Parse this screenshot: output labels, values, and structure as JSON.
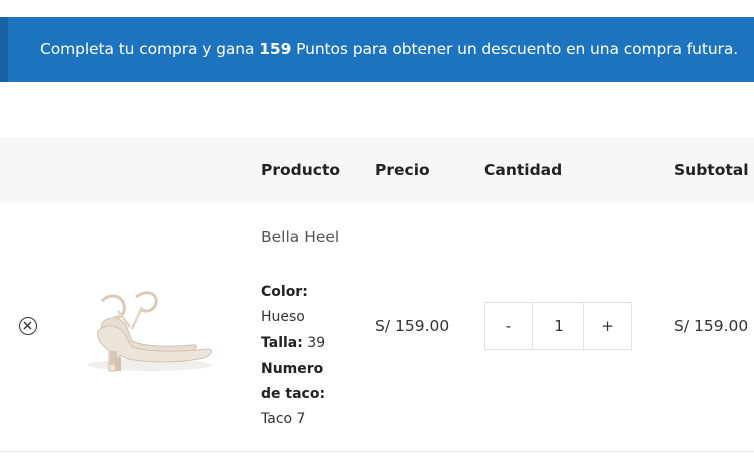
{
  "notice": {
    "prefix": "Completa tu compra y gana ",
    "points": "159",
    "suffix": " Puntos para obtener un descuento en una compra futura."
  },
  "table": {
    "headers": {
      "producto": "Producto",
      "precio": "Precio",
      "cantidad": "Cantidad",
      "subtotal": "Subtotal"
    }
  },
  "item": {
    "name": "Bella Heel",
    "color_label": "Color:",
    "color_value": "Hueso",
    "talla_label": "Talla:",
    "talla_value": "39",
    "taco_label": "Numero de taco:",
    "taco_value": "Taco 7",
    "price": "S/ 159.00",
    "quantity": "1",
    "minus": "-",
    "plus": "+",
    "subtotal": "S/ 159.00",
    "image_icon": "shoe-thumbnail"
  },
  "colors": {
    "notice_bg": "#1e73be",
    "header_bg": "#f7f7f7"
  }
}
